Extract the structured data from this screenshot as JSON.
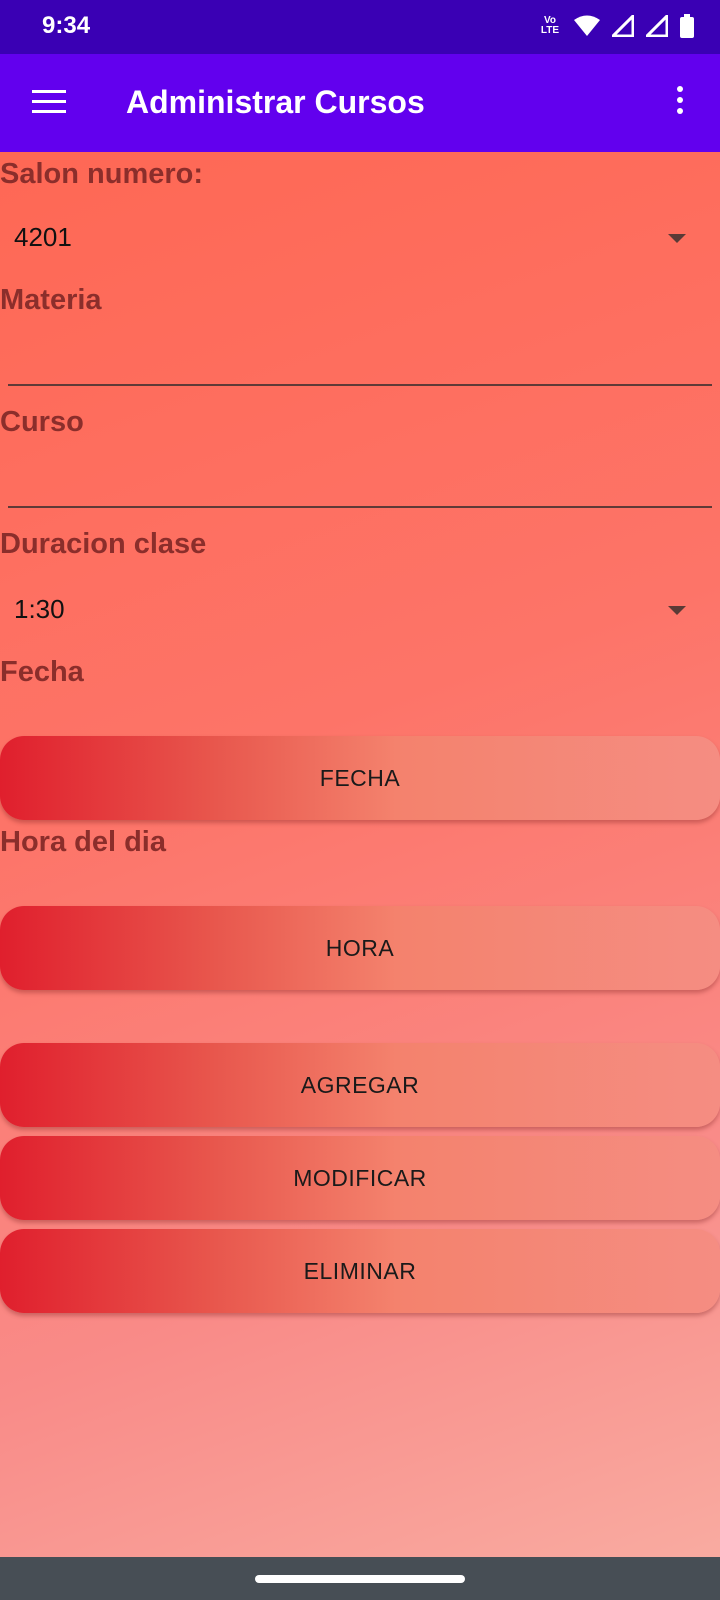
{
  "status_bar": {
    "time": "9:34",
    "volte_top": "Vo",
    "volte_bottom": "LTE",
    "icons": [
      "volte-icon",
      "wifi-icon",
      "signal-icon",
      "signal-icon",
      "battery-icon"
    ]
  },
  "app_bar": {
    "title": "Administrar Cursos",
    "menu_icon": "hamburger-menu-icon",
    "overflow_icon": "more-vert-icon",
    "color": "#6200ee"
  },
  "form": {
    "salon_label": "Salon numero:",
    "salon_value": "4201",
    "materia_label": "Materia",
    "materia_value": "",
    "curso_label": "Curso",
    "curso_value": "",
    "duracion_label": "Duracion clase",
    "duracion_value": "1:30",
    "fecha_label": "Fecha",
    "fecha_button": "FECHA",
    "hora_label": "Hora del dia",
    "hora_button": "HORA"
  },
  "actions": {
    "agregar": "AGREGAR",
    "modificar": "MODIFICAR",
    "eliminar": "ELIMINAR"
  },
  "colors": {
    "status_bar": "#3a00b4",
    "label_text": "#8b2e2b",
    "button_start": "#e01f2d",
    "button_end": "#f58d82"
  }
}
